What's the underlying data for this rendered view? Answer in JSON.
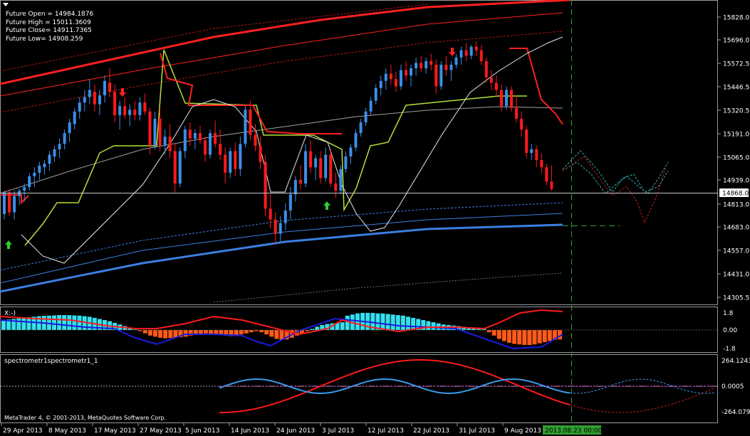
{
  "info": {
    "future_open": "Future Open = 14984.1876",
    "future_high": "Future High = 15011.3609",
    "future_close": "Future Close= 14911.7365",
    "future_low": "Future Low= 14908.259"
  },
  "price_axis": {
    "labels": [
      "15828.0",
      "15696.0",
      "15572.5",
      "15446.5",
      "15320.5",
      "15191.0",
      "15065.0",
      "14939.0",
      "14868.0",
      "14813.0",
      "14683.0",
      "14557.0",
      "14431.0",
      "14305.5"
    ],
    "current_price": "14868.0"
  },
  "osc1": {
    "label": "X:-)",
    "axis": [
      "1.8",
      "0.00",
      "-1.8"
    ]
  },
  "osc2": {
    "label": "spectrometr1spectrometr1_1",
    "axis": [
      "264.1243",
      "0.0005",
      "-264.0793"
    ]
  },
  "time_axis": {
    "labels": [
      "29 Apr 2013",
      "8 May 2013",
      "17 May 2013",
      "27 May 2013",
      "5 Jun 2013",
      "14 Jun 2013",
      "24 Jun 2013",
      "3 Jul 2013",
      "12 Jul 2013",
      "22 Jul 2013",
      "31 Jul 2013",
      "9 Aug 2013"
    ],
    "cursor_label": "2013.08.23 00:00"
  },
  "copyright": "MetaTrader 4, © 2001-2013, MetaQuotes Software Corp.",
  "chart_data": {
    "type": "bar",
    "symbol_panel": "main-price",
    "ylim": [
      14240,
      15880
    ],
    "colors": {
      "up": "#3a8fe8",
      "down": "#ff1a1a",
      "cursor": "#2f9e2f",
      "osc_up": "#33e0f0",
      "osc_down": "#ff5a1a"
    },
    "bars": [
      [
        14730,
        14860,
        14700,
        14850
      ],
      [
        14850,
        14870,
        14720,
        14740
      ],
      [
        14740,
        14860,
        14700,
        14830
      ],
      [
        14830,
        14870,
        14780,
        14860
      ],
      [
        14860,
        14900,
        14800,
        14880
      ],
      [
        14880,
        14960,
        14860,
        14940
      ],
      [
        14940,
        14990,
        14880,
        14960
      ],
      [
        14960,
        15020,
        14920,
        15000
      ],
      [
        14990,
        15030,
        14950,
        15010
      ],
      [
        15010,
        15080,
        14970,
        15060
      ],
      [
        15050,
        15110,
        15020,
        15090
      ],
      [
        15090,
        15150,
        15040,
        15120
      ],
      [
        15120,
        15200,
        15090,
        15180
      ],
      [
        15180,
        15260,
        15130,
        15240
      ],
      [
        15230,
        15320,
        15200,
        15300
      ],
      [
        15300,
        15380,
        15260,
        15350
      ],
      [
        15350,
        15420,
        15300,
        15380
      ],
      [
        15380,
        15480,
        15340,
        15420
      ],
      [
        15410,
        15450,
        15300,
        15340
      ],
      [
        15340,
        15420,
        15280,
        15390
      ],
      [
        15390,
        15500,
        15350,
        15470
      ],
      [
        15460,
        15540,
        15380,
        15410
      ],
      [
        15410,
        15450,
        15240,
        15280
      ],
      [
        15280,
        15360,
        15200,
        15330
      ],
      [
        15330,
        15380,
        15260,
        15280
      ],
      [
        15280,
        15340,
        15220,
        15310
      ],
      [
        15310,
        15360,
        15250,
        15280
      ],
      [
        15280,
        15380,
        15250,
        15350
      ],
      [
        15350,
        15400,
        15280,
        15300
      ],
      [
        15300,
        15320,
        15060,
        15110
      ],
      [
        15110,
        15300,
        15090,
        15260
      ],
      [
        15260,
        15320,
        15080,
        15110
      ],
      [
        15110,
        15200,
        15060,
        15160
      ],
      [
        15160,
        15230,
        15040,
        15080
      ],
      [
        15080,
        15120,
        14850,
        14900
      ],
      [
        14900,
        15100,
        14880,
        15080
      ],
      [
        15080,
        15220,
        15040,
        15200
      ],
      [
        15200,
        15240,
        15110,
        15150
      ],
      [
        15150,
        15200,
        15090,
        15180
      ],
      [
        15180,
        15220,
        15120,
        15140
      ],
      [
        15140,
        15160,
        15020,
        15060
      ],
      [
        15060,
        15200,
        15040,
        15180
      ],
      [
        15180,
        15250,
        15100,
        15120
      ],
      [
        15120,
        15200,
        15030,
        15060
      ],
      [
        15060,
        15100,
        14900,
        14960
      ],
      [
        14960,
        15100,
        14930,
        15080
      ],
      [
        15080,
        15130,
        14940,
        14980
      ],
      [
        14980,
        15160,
        14940,
        15120
      ],
      [
        15120,
        15330,
        15100,
        15310
      ],
      [
        15310,
        15360,
        15140,
        15170
      ],
      [
        15170,
        15230,
        15080,
        15110
      ],
      [
        15110,
        15160,
        14980,
        15020
      ],
      [
        15020,
        15060,
        14720,
        14760
      ],
      [
        14760,
        14840,
        14650,
        14700
      ],
      [
        14700,
        14740,
        14560,
        14620
      ],
      [
        14620,
        14720,
        14580,
        14680
      ],
      [
        14680,
        14790,
        14640,
        14750
      ],
      [
        14750,
        14880,
        14700,
        14840
      ],
      [
        14840,
        14940,
        14800,
        14920
      ],
      [
        14920,
        15000,
        14870,
        14900
      ],
      [
        14900,
        15120,
        14880,
        15080
      ],
      [
        15080,
        15140,
        14960,
        14990
      ],
      [
        14990,
        15060,
        14920,
        15040
      ],
      [
        15040,
        15080,
        14900,
        14930
      ],
      [
        14930,
        15100,
        14910,
        15060
      ],
      [
        15060,
        15090,
        14880,
        14900
      ],
      [
        14900,
        14960,
        14820,
        14860
      ],
      [
        14860,
        15000,
        14840,
        14980
      ],
      [
        14980,
        15080,
        14960,
        15050
      ],
      [
        15050,
        15120,
        15010,
        15100
      ],
      [
        15100,
        15200,
        15080,
        15180
      ],
      [
        15180,
        15260,
        15160,
        15240
      ],
      [
        15240,
        15320,
        15220,
        15300
      ],
      [
        15300,
        15380,
        15280,
        15360
      ],
      [
        15360,
        15450,
        15340,
        15430
      ],
      [
        15430,
        15500,
        15390,
        15470
      ],
      [
        15470,
        15540,
        15420,
        15510
      ],
      [
        15510,
        15560,
        15450,
        15480
      ],
      [
        15480,
        15520,
        15410,
        15440
      ],
      [
        15440,
        15560,
        15420,
        15530
      ],
      [
        15530,
        15580,
        15470,
        15500
      ],
      [
        15500,
        15560,
        15440,
        15540
      ],
      [
        15540,
        15600,
        15500,
        15570
      ],
      [
        15570,
        15610,
        15520,
        15540
      ],
      [
        15540,
        15600,
        15510,
        15580
      ],
      [
        15580,
        15620,
        15530,
        15560
      ],
      [
        15560,
        15590,
        15400,
        15440
      ],
      [
        15440,
        15580,
        15420,
        15560
      ],
      [
        15560,
        15610,
        15500,
        15530
      ],
      [
        15530,
        15580,
        15470,
        15560
      ],
      [
        15560,
        15620,
        15540,
        15600
      ],
      [
        15600,
        15660,
        15560,
        15640
      ],
      [
        15640,
        15680,
        15580,
        15610
      ],
      [
        15610,
        15670,
        15590,
        15660
      ],
      [
        15660,
        15690,
        15610,
        15640
      ],
      [
        15640,
        15670,
        15560,
        15580
      ],
      [
        15580,
        15600,
        15460,
        15490
      ],
      [
        15490,
        15530,
        15420,
        15460
      ],
      [
        15460,
        15500,
        15380,
        15420
      ],
      [
        15420,
        15450,
        15300,
        15330
      ],
      [
        15330,
        15440,
        15310,
        15420
      ],
      [
        15420,
        15440,
        15300,
        15320
      ],
      [
        15320,
        15380,
        15240,
        15260
      ],
      [
        15260,
        15300,
        15160,
        15200
      ],
      [
        15200,
        15220,
        15040,
        15070
      ],
      [
        15070,
        15120,
        15030,
        15090
      ],
      [
        15090,
        15110,
        14990,
        15030
      ],
      [
        15030,
        15070,
        14960,
        14990
      ],
      [
        14990,
        15010,
        14890,
        14910
      ],
      [
        14910,
        15000,
        14860,
        14870
      ]
    ],
    "oscillator_histogram": [
      0.9,
      0.95,
      1.0,
      1.05,
      1.1,
      1.15,
      1.2,
      1.25,
      1.28,
      1.3,
      1.32,
      1.35,
      1.35,
      1.34,
      1.32,
      1.3,
      1.25,
      1.2,
      1.1,
      1.0,
      0.9,
      0.8,
      0.65,
      0.5,
      0.35,
      0.2,
      0.05,
      -0.1,
      -0.3,
      -0.5,
      -0.6,
      -0.7,
      -0.75,
      -0.72,
      -0.7,
      -0.65,
      -0.6,
      -0.5,
      -0.4,
      -0.35,
      -0.3,
      -0.35,
      -0.4,
      -0.45,
      -0.5,
      -0.55,
      -0.5,
      -0.4,
      -0.3,
      -0.2,
      -0.1,
      -0.2,
      -0.4,
      -0.6,
      -0.8,
      -0.9,
      -0.85,
      -0.7,
      -0.5,
      -0.3,
      -0.1,
      0.1,
      0.3,
      0.45,
      0.55,
      0.6,
      0.65,
      0.7,
      1.3,
      1.4,
      1.5,
      1.55,
      1.55,
      1.55,
      1.5,
      1.5,
      1.45,
      1.4,
      1.35,
      1.3,
      1.2,
      1.1,
      1.0,
      0.9,
      0.8,
      0.7,
      0.6,
      0.5,
      0.45,
      0.4,
      0.35,
      0.3,
      0.25,
      0.2,
      0.15,
      0.1,
      -0.2,
      -0.5,
      -0.8,
      -1.0,
      -1.15,
      -1.25,
      -1.3,
      -1.35,
      -1.35,
      -1.3,
      -1.2,
      -1.1,
      -1.0,
      -0.9,
      -0.85
    ]
  }
}
